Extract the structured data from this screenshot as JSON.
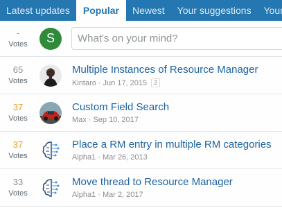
{
  "tabs": [
    "Latest updates",
    "Popular",
    "Newest",
    "Your suggestions",
    "Your vo"
  ],
  "composer": {
    "votes_count": "-",
    "votes_label": "Votes",
    "avatar_letter": "S",
    "avatar_color": "#2f8a3a",
    "placeholder": "What's on your mind?"
  },
  "items": [
    {
      "votes": "65",
      "votes_label": "Votes",
      "title": "Multiple Instances of Resource Manager",
      "author": "Kintaro",
      "date": "Jun 17, 2015",
      "pages": "2",
      "avatar": "person-photo"
    },
    {
      "votes": "37",
      "votes_label": "Votes",
      "title": "Custom Field Search",
      "author": "Max",
      "date": "Sep 10, 2017",
      "avatar": "car-photo"
    },
    {
      "votes": "37",
      "votes_label": "Votes",
      "title": "Place a RM entry in multiple RM categories",
      "author": "Alpha1",
      "date": "Mar 26, 2013",
      "avatar": "brain-icon"
    },
    {
      "votes": "33",
      "votes_label": "Votes",
      "title": "Move thread to Resource Manager",
      "author": "Alpha1",
      "date": "Mar 2, 2017",
      "avatar": "brain-icon"
    }
  ],
  "colors": {
    "accent": "#2577b1",
    "link": "#1d62a0",
    "hot_votes": "#e8a21f"
  }
}
